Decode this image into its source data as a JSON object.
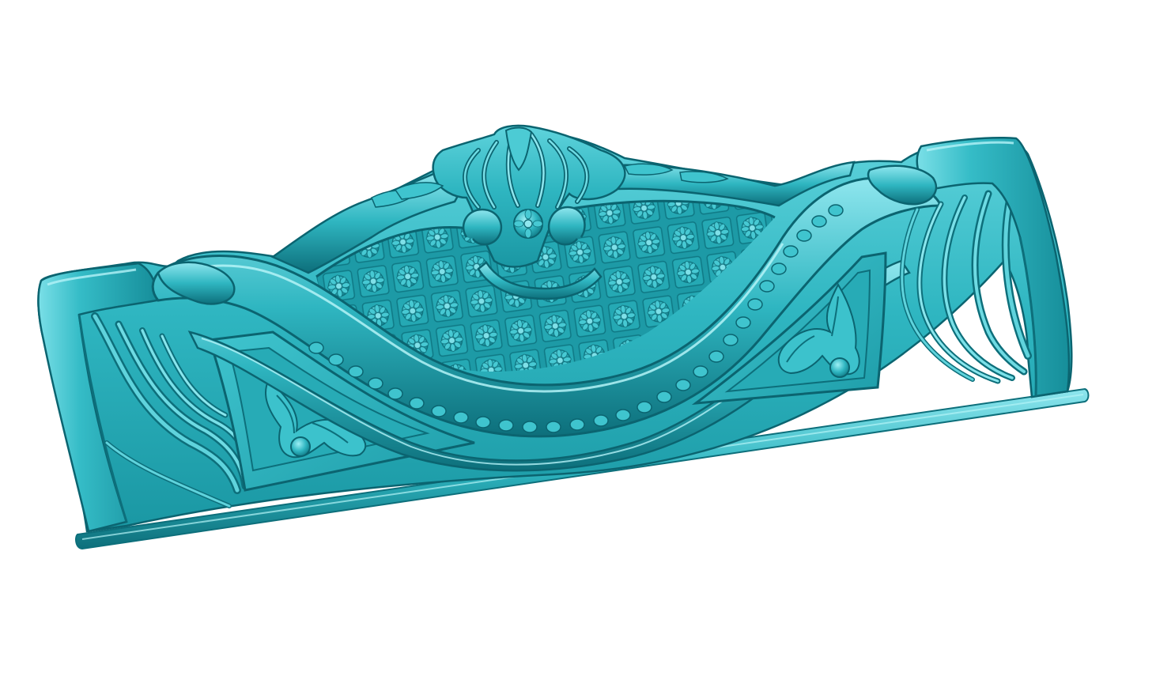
{
  "model": {
    "subject": "carved-headboard-relief",
    "render_style": "shaded-3d-relief",
    "colors": {
      "background": "#ffffff",
      "base": "#2fb6c1",
      "highlight": "#8fe6ee",
      "mid": "#1fa3af",
      "shadow": "#0d6f7b",
      "deep_shadow": "#075863"
    },
    "motifs": {
      "crest": "palmette-crest",
      "panel_pattern": "rosette-lattice",
      "side_panels": "draped-fabric-folds",
      "corner_ornaments": "acanthus-leaf-carvings",
      "edge_trim": "bead-and-scallop-trim"
    },
    "rosette_grid": {
      "rows": 5,
      "columns": 11
    }
  }
}
